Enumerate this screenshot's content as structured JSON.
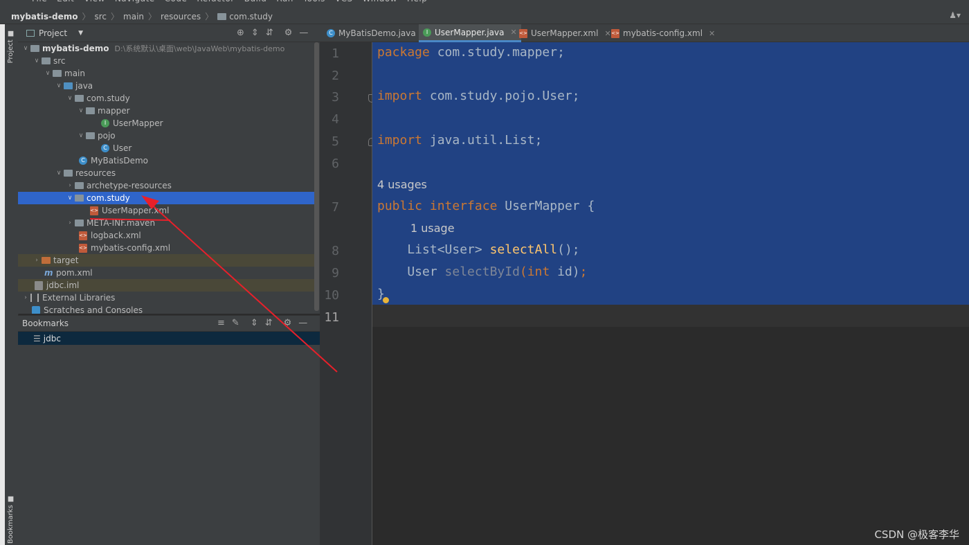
{
  "menu": [
    "File",
    "Edit",
    "View",
    "Navigate",
    "Code",
    "Refactor",
    "Build",
    "Run",
    "Tools",
    "VCS",
    "Window",
    "Help"
  ],
  "breadcrumb": {
    "project": "mybatis-demo",
    "items": [
      "src",
      "main",
      "resources",
      "com.study"
    ]
  },
  "toolwindow": {
    "project_label": "Project",
    "bookmarks_label": "Bookmarks"
  },
  "project_panel": {
    "title": "Project"
  },
  "tree": {
    "root": "mybatis-demo",
    "root_path": "D:\\系统默认\\桌面\\web\\JavaWeb\\mybatis-demo",
    "src": "src",
    "main": "main",
    "java": "java",
    "com_study": "com.study",
    "mapper": "mapper",
    "user_mapper": "UserMapper",
    "pojo": "pojo",
    "user": "User",
    "mybatis_demo": "MyBatisDemo",
    "resources": "resources",
    "archetype": "archetype-resources",
    "res_com_study": "com.study",
    "user_mapper_xml": "UserMapper.xml",
    "meta_inf": "META-INF.maven",
    "logback": "logback.xml",
    "mybatis_config": "mybatis-config.xml",
    "target": "target",
    "pom": "pom.xml",
    "jdbc_iml": "jdbc.iml",
    "external": "External Libraries",
    "scratches": "Scratches and Consoles"
  },
  "bookmarks": {
    "title": "Bookmarks",
    "items": [
      "jdbc"
    ]
  },
  "tabs": [
    "MyBatisDemo.java",
    "UserMapper.java",
    "UserMapper.xml",
    "mybatis-config.xml"
  ],
  "editor": {
    "line_numbers": [
      "1",
      "2",
      "3",
      "4",
      "5",
      "6",
      "7",
      "8",
      "9",
      "10",
      "11"
    ],
    "l1_kw": "package",
    "l1_rest": " com.study.mapper;",
    "l3_kw": "import",
    "l3_rest": " com.study.pojo.User;",
    "l5_kw": "import",
    "l5_rest": " java.util.List;",
    "hint1": "4 usages",
    "l7_kw1": "public",
    "l7_kw2": "interface",
    "l7_rest": " UserMapper {",
    "hint2": "1 usage",
    "l8_type": "    List<User> ",
    "l8_fn": "selectAll",
    "l8_end": "();",
    "l9_type": "    User ",
    "l9_fn": "selectById",
    "l9_open": "(",
    "l9_kw": "int",
    "l9_arg": " id)",
    "l9_semi": ";",
    "l10": "}"
  },
  "watermark": "CSDN @极客李华",
  "colors": {
    "selection": "#214283",
    "keyword": "#cc7832",
    "method": "#ffc66d",
    "annotation_arrow": "#e8202a",
    "selected_row": "#2f65ca"
  }
}
